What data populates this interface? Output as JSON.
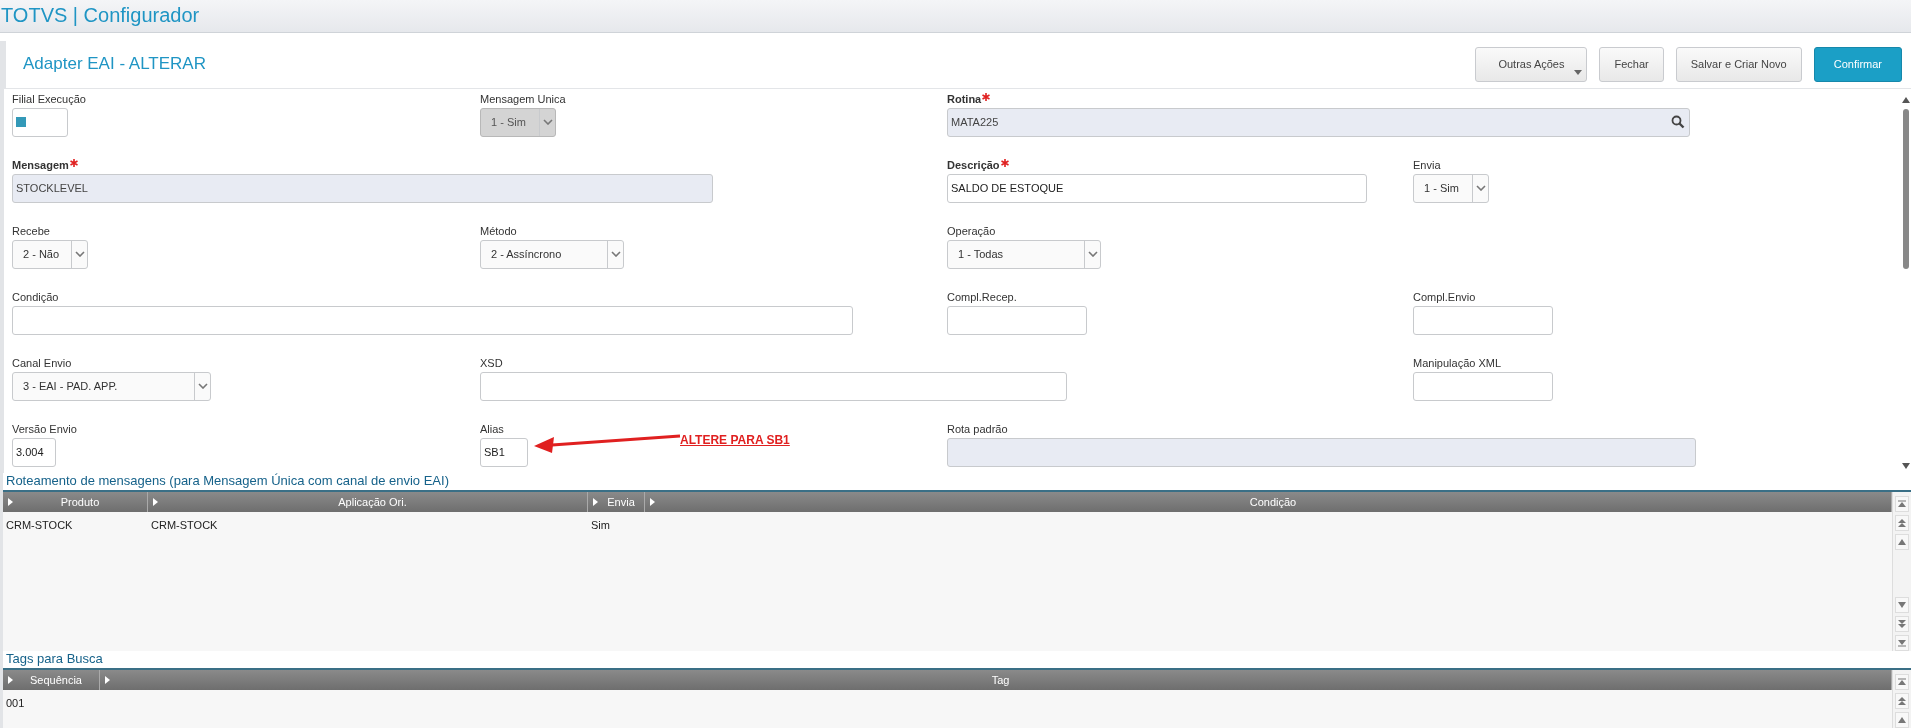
{
  "app_title": "TOTVS | Configurador",
  "page_title": "Adapter EAI - ALTERAR",
  "buttons": [
    {
      "label": "Outras Ações",
      "kind": "menu"
    },
    {
      "label": "Fechar",
      "kind": "default"
    },
    {
      "label": "Salvar e Criar Novo",
      "kind": "default"
    },
    {
      "label": "Confirmar",
      "kind": "primary"
    }
  ],
  "form_rows": [
    [
      {
        "label": "Filial Execução",
        "kind": "swatch",
        "required": false,
        "disabled": false
      },
      {
        "label": "Mensagem Unica",
        "kind": "select",
        "value": "1 - Sim",
        "required": false,
        "disabled": true
      },
      {
        "label": "Rotina",
        "kind": "lookup",
        "value": "MATA225",
        "required": true,
        "disabled": true
      }
    ],
    [
      {
        "label": "Mensagem",
        "kind": "text",
        "value": "STOCKLEVEL",
        "required": true,
        "disabled": true
      },
      {
        "label": "Descrição",
        "kind": "text",
        "value": "SALDO DE ESTOQUE",
        "required": true,
        "disabled": false
      },
      {
        "label": "Envia",
        "kind": "select",
        "value": "1 - Sim",
        "required": false,
        "disabled": false
      }
    ],
    [
      {
        "label": "Recebe",
        "kind": "select",
        "value": "2 - Não",
        "required": false,
        "disabled": false
      },
      {
        "label": "Método",
        "kind": "select",
        "value": "2 - Assíncrono",
        "required": false,
        "disabled": false
      },
      {
        "label": "Operação",
        "kind": "select",
        "value": "1 - Todas",
        "required": false,
        "disabled": false
      }
    ],
    [
      {
        "label": "Condição",
        "kind": "text",
        "required": false,
        "disabled": false
      },
      {
        "label": "Compl.Recep.",
        "kind": "text",
        "required": false,
        "disabled": false
      },
      {
        "label": "Compl.Envio",
        "kind": "text",
        "required": false,
        "disabled": false
      }
    ],
    [
      {
        "label": "Canal Envio",
        "kind": "select",
        "value": "3 - EAI - PAD. APP.",
        "required": false,
        "disabled": false
      },
      {
        "label": "XSD",
        "kind": "text",
        "required": false,
        "disabled": false
      },
      {
        "label": "Manipulação XML",
        "kind": "text",
        "required": false,
        "disabled": false
      }
    ],
    [
      {
        "label": "Versão Envio",
        "kind": "text",
        "value": "3.004",
        "required": false,
        "disabled": false
      },
      {
        "label": "Alias",
        "kind": "text",
        "value": "SB1",
        "required": false,
        "disabled": false,
        "annotation": "ALTERE PARA SB1"
      },
      {
        "label": "Rota padrão",
        "kind": "text",
        "required": false,
        "disabled": true
      }
    ]
  ],
  "grids": [
    {
      "title": "Roteamento de mensagens (para Mensagem Única com canal de envio EAI)",
      "columns": [
        "Produto",
        "Aplicação Ori.",
        "Envia",
        "Condição"
      ],
      "rows": [
        [
          "CRM-STOCK",
          "CRM-STOCK",
          "Sim",
          ""
        ]
      ]
    },
    {
      "title": "Tags para Busca",
      "columns": [
        "Sequência",
        "Tag"
      ],
      "rows": [
        [
          "001",
          ""
        ]
      ]
    }
  ]
}
